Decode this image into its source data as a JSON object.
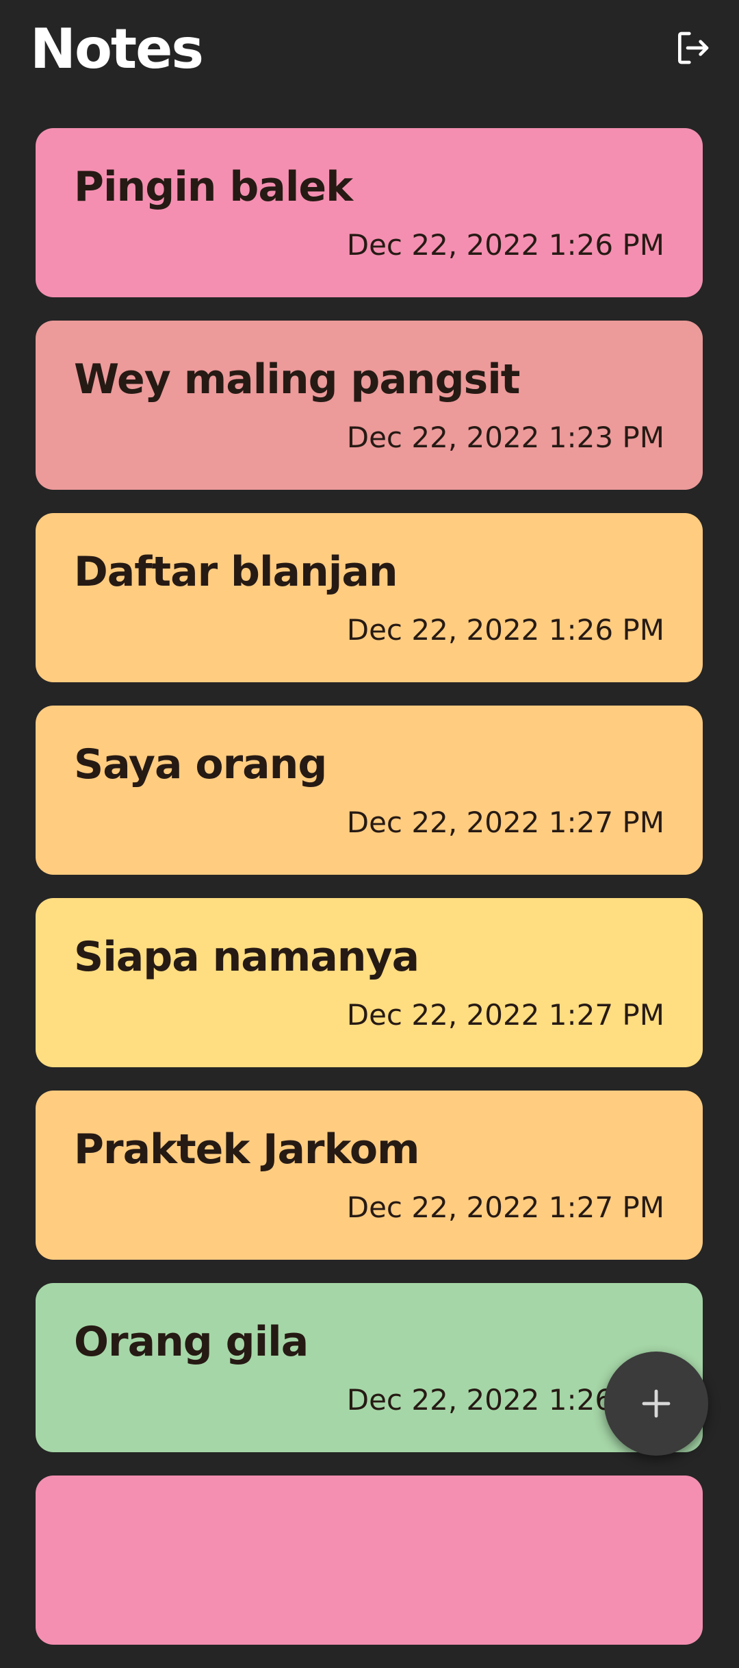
{
  "header": {
    "title": "Notes",
    "logout_icon": "logout-icon"
  },
  "notes": [
    {
      "title": "Pingin balek",
      "date": "Dec 22, 2022 1:26 PM",
      "color": "#F48FB1"
    },
    {
      "title": "Wey maling pangsit",
      "date": "Dec 22, 2022 1:23 PM",
      "color": "#EC9A9A"
    },
    {
      "title": "Daftar blanjan",
      "date": "Dec 22, 2022 1:26 PM",
      "color": "#FFCC80"
    },
    {
      "title": "Saya orang",
      "date": "Dec 22, 2022 1:27 PM",
      "color": "#FFCC80"
    },
    {
      "title": "Siapa namanya",
      "date": "Dec 22, 2022 1:27 PM",
      "color": "#FFDD81"
    },
    {
      "title": "Praktek Jarkom",
      "date": "Dec 22, 2022 1:27 PM",
      "color": "#FFCC80"
    },
    {
      "title": "Orang gila",
      "date": "Dec 22, 2022 1:26 PM",
      "color": "#A5D6A7"
    },
    {
      "title": "",
      "date": "",
      "color": "#F48FB1"
    }
  ],
  "fab": {
    "icon": "plus-icon"
  },
  "colors": {
    "background": "#252525",
    "fab": "#3B3B3B",
    "text_dark": "#261A14"
  }
}
